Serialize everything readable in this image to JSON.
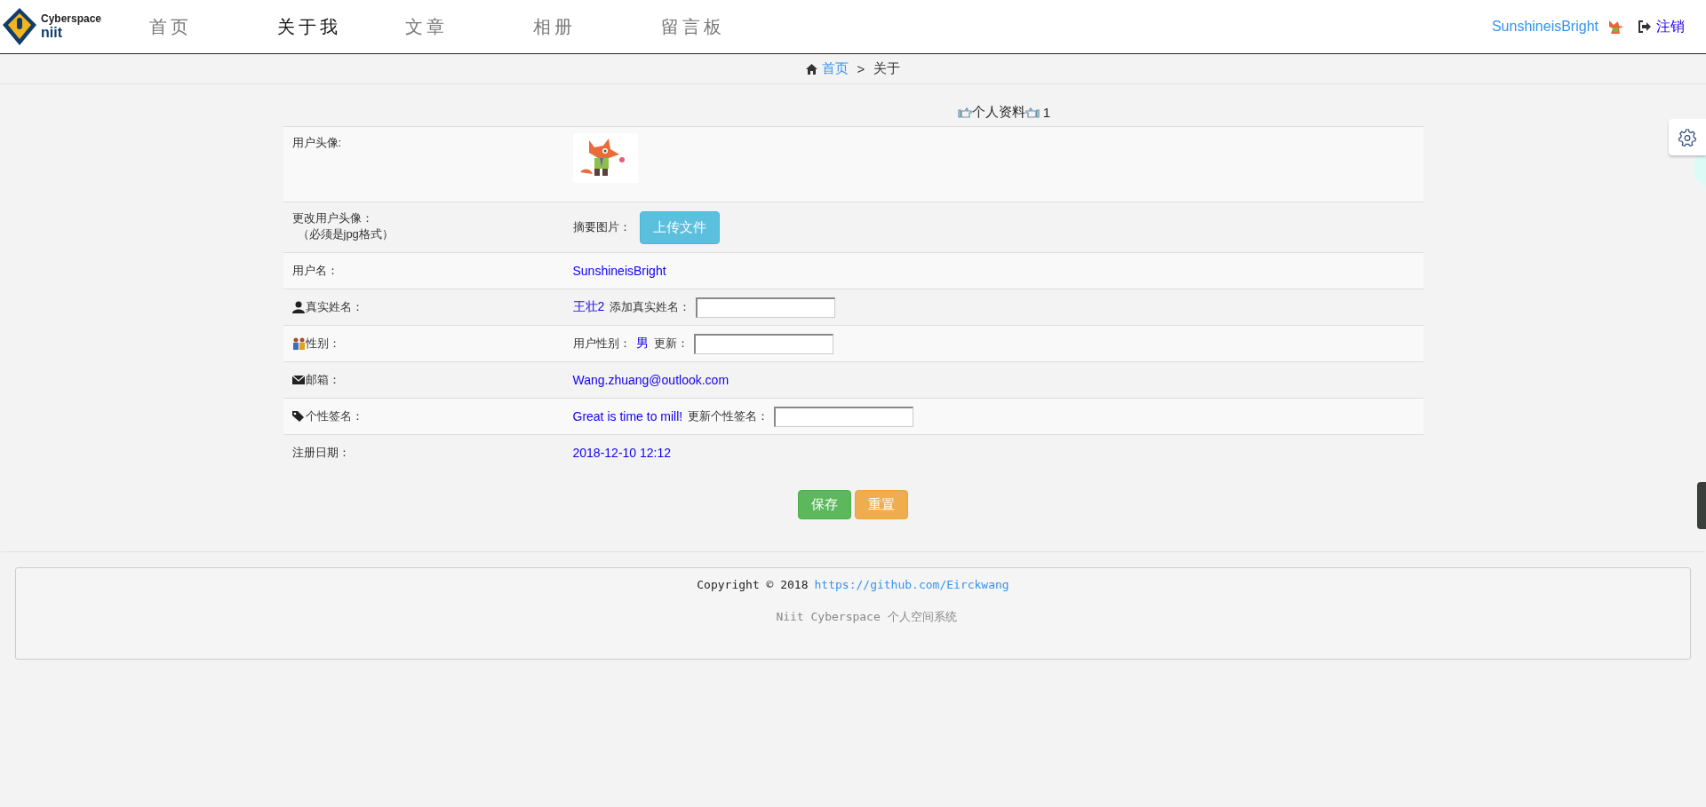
{
  "header": {
    "logo": {
      "line1": "Cyberspace",
      "line2": "niit"
    },
    "nav": [
      {
        "label": "首页",
        "selected": false
      },
      {
        "label": "关于我",
        "selected": true
      },
      {
        "label": "文章",
        "selected": false
      },
      {
        "label": "相册",
        "selected": false
      },
      {
        "label": "留言板",
        "selected": false
      }
    ],
    "user": {
      "name": "SunshineisBright",
      "logout": "注销"
    }
  },
  "breadcrumb": [
    {
      "kind": "link",
      "label": "首页"
    },
    {
      "kind": "separator",
      "label": ">"
    },
    {
      "kind": "current",
      "label": "关于"
    }
  ],
  "profile": {
    "title": "个人资料",
    "count": "1",
    "rows": [
      {
        "kind": "avatar",
        "label": "用户头像:"
      },
      {
        "kind": "upload",
        "label": "更改用户头像：",
        "note": "（必须是jpg格式）",
        "field_label": "摘要图片：",
        "button": "上传文件"
      },
      {
        "kind": "value",
        "label": "用户名：",
        "value": "SunshineisBright"
      },
      {
        "kind": "value_input",
        "label": "真实姓名：",
        "value": "王壮2",
        "input_label": "添加真实姓名："
      },
      {
        "kind": "prefixed_input",
        "label": "性别：",
        "prefix": "用户性别：",
        "value": "男",
        "input_label": "更新："
      },
      {
        "kind": "value",
        "label": "邮箱：",
        "value": "Wang.zhuang@outlook.com"
      },
      {
        "kind": "value_input",
        "label": "个性签名：",
        "value": "Great is time to mill!",
        "input_label": "更新个性签名："
      },
      {
        "kind": "value",
        "label": "注册日期：",
        "value": "2018-12-10 12:12"
      }
    ]
  },
  "buttons": [
    {
      "kind": "save",
      "label": "保存"
    },
    {
      "kind": "reset",
      "label": "重置"
    }
  ],
  "footer": {
    "copyright": "Copyright © 2018",
    "link": "https://github.com/Eirckwang",
    "tagline": "Niit Cyberspace 个人空间系统"
  }
}
